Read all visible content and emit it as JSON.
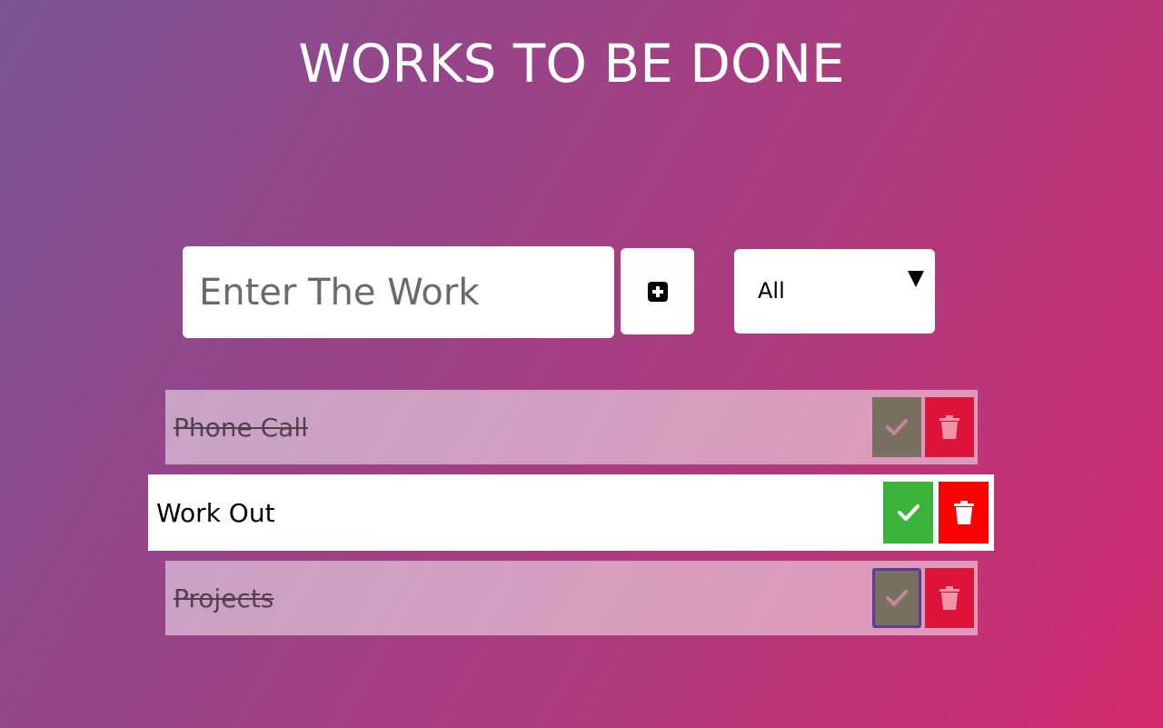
{
  "header": {
    "title": "WORKS TO BE DONE"
  },
  "form": {
    "input_placeholder": "Enter The Work",
    "input_value": "",
    "add_icon": "plus-square-icon",
    "filter_selected": "All"
  },
  "todos": [
    {
      "text": "Phone Call",
      "completed": true
    },
    {
      "text": "Work Out",
      "completed": false
    },
    {
      "text": "Projects",
      "completed": true
    }
  ],
  "colors": {
    "check_active": "#3bb33b",
    "trash_active": "#ff0000",
    "check_completed": "#7a7060",
    "trash_completed": "#dc143c"
  },
  "icons": {
    "check": "check-icon",
    "trash": "trash-icon",
    "dropdown": "caret-down-icon"
  }
}
